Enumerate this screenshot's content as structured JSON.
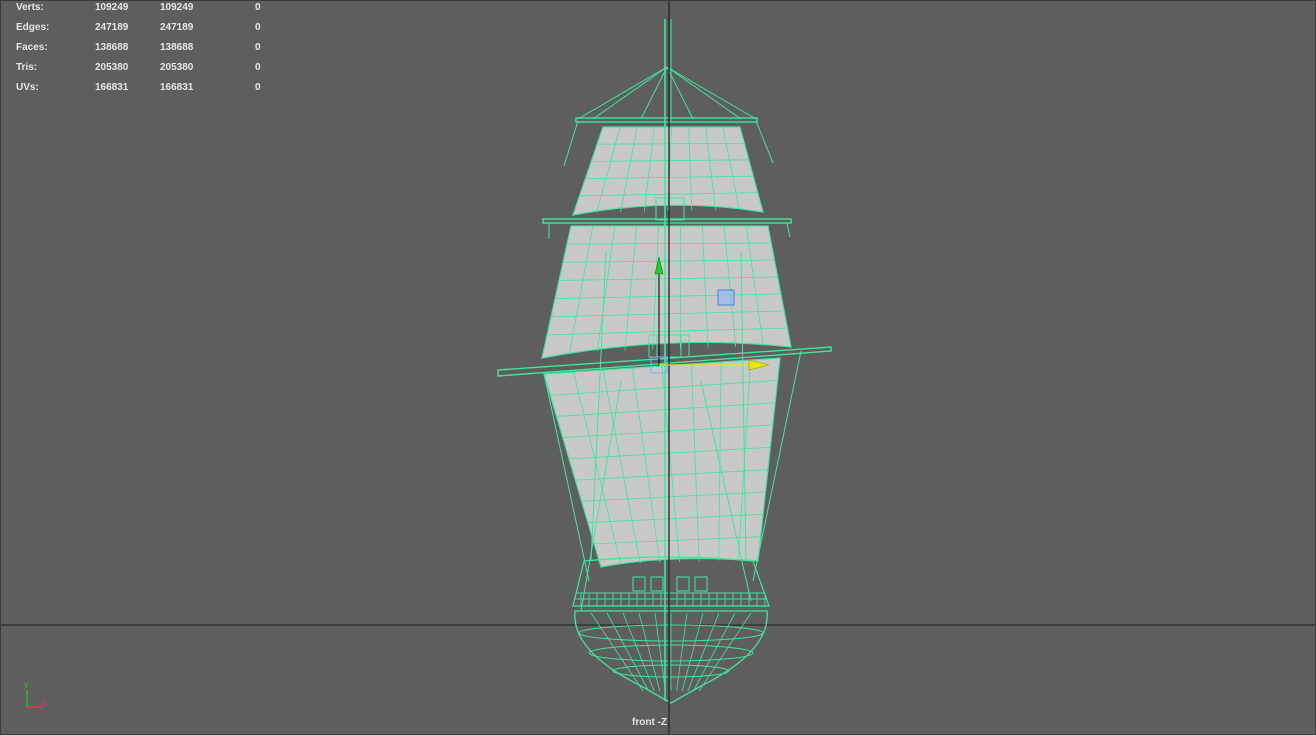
{
  "hud": {
    "rows": [
      {
        "label": "Verts:",
        "v1": "109249",
        "v2": "109249",
        "v3": "0"
      },
      {
        "label": "Edges:",
        "v1": "247189",
        "v2": "247189",
        "v3": "0"
      },
      {
        "label": "Faces:",
        "v1": "138688",
        "v2": "138688",
        "v3": "0"
      },
      {
        "label": "Tris:",
        "v1": "205380",
        "v2": "205380",
        "v3": "0"
      },
      {
        "label": "UVs:",
        "v1": "166831",
        "v2": "166831",
        "v3": "0"
      }
    ]
  },
  "viewport": {
    "camera_label": "front -Z",
    "axis": {
      "y_label": "y",
      "x_label": "x"
    }
  },
  "colors": {
    "background": "#5e5e5e",
    "wireframe": "#3fe6a0",
    "sail_fill": "#c9c9c9",
    "axis_y": "#22cc22",
    "axis_x": "#e6e600",
    "axis_red": "#ff3030",
    "guide_line": "#2b2b2b"
  },
  "icons": [
    "move-manipulator-icon",
    "move-x-handle-icon",
    "move-y-handle-icon",
    "view-axis-icon"
  ]
}
